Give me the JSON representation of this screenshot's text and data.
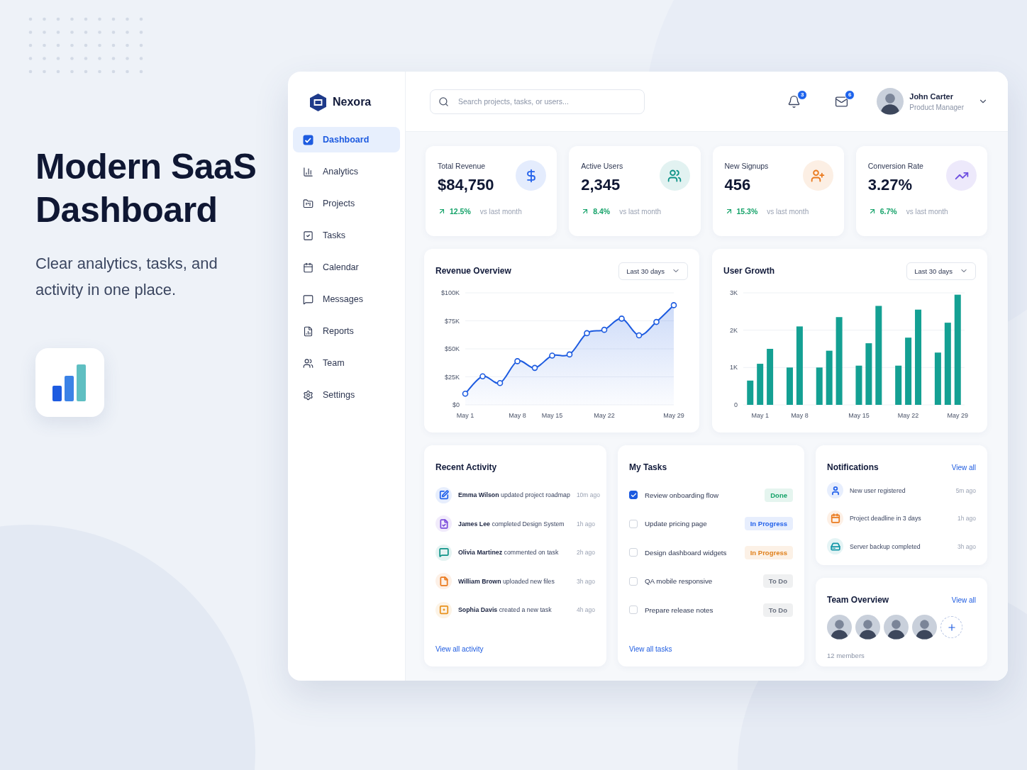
{
  "hero": {
    "title": "Modern SaaS Dashboard",
    "subtitle": "Clear analytics, tasks, and activity in one place."
  },
  "brand": {
    "name": "Nexora"
  },
  "sidebar": {
    "items": [
      {
        "label": "Dashboard",
        "selected": true
      },
      {
        "label": "Analytics",
        "selected": false
      },
      {
        "label": "Projects",
        "selected": false
      },
      {
        "label": "Tasks",
        "selected": false
      },
      {
        "label": "Calendar",
        "selected": false
      },
      {
        "label": "Messages",
        "selected": false
      },
      {
        "label": "Reports",
        "selected": false
      },
      {
        "label": "Team",
        "selected": false
      },
      {
        "label": "Settings",
        "selected": false
      }
    ]
  },
  "header": {
    "search": {
      "placeholder": "Search projects, tasks, or users..."
    },
    "notifications_count": "3",
    "messages_count": "6",
    "user": {
      "name": "John Carter",
      "role": "Product Manager"
    }
  },
  "stats": [
    {
      "title": "Total Revenue",
      "value": "$84,750",
      "change": "12.5%",
      "period": "vs last month",
      "color": "#2563eb"
    },
    {
      "title": "Active Users",
      "value": "2,345",
      "change": "8.4%",
      "period": "vs last month",
      "color": "#0f9488"
    },
    {
      "title": "New Signups",
      "value": "456",
      "change": "15.3%",
      "period": "vs last month",
      "color": "#ea7a1e"
    },
    {
      "title": "Conversion Rate",
      "value": "3.27%",
      "change": "6.7%",
      "period": "vs last month",
      "color": "#6d4ee0"
    }
  ],
  "revenue_overview": {
    "title": "Revenue Overview",
    "range": "Last 30 days",
    "chart_data": {
      "type": "area",
      "categories": [
        "May 1",
        null,
        null,
        "May 8",
        null,
        "May 15",
        null,
        null,
        "May 22",
        null,
        null,
        null,
        "May 29"
      ],
      "grid": true,
      "series": [
        {
          "color": "#1d5be0",
          "values": [
            10,
            25.5,
            19.5,
            39,
            33,
            44,
            45,
            64,
            67,
            77,
            62,
            74,
            89
          ]
        }
      ],
      "ylim": [
        0,
        100
      ],
      "yticks": [
        {
          "value": 0,
          "label": "$0"
        },
        {
          "value": 25,
          "label": "$25K"
        },
        {
          "value": 50,
          "label": "$50K"
        },
        {
          "value": 75,
          "label": "$75K"
        },
        {
          "value": 100,
          "label": "$100K"
        }
      ]
    }
  },
  "user_growth": {
    "title": "User Growth",
    "range": "Last 30 days",
    "chart_data": {
      "type": "bar",
      "categories": [
        null,
        "May 1",
        null,
        null,
        null,
        "May 8",
        null,
        null,
        null,
        null,
        null,
        "May 15",
        null,
        null,
        null,
        null,
        "May 22",
        null,
        null,
        null,
        null,
        "May 29"
      ],
      "grid": true,
      "series": [
        {
          "color": "#14a093",
          "values": [
            650,
            1100,
            1500,
            null,
            1000,
            2100,
            null,
            1000,
            1450,
            2350,
            null,
            1050,
            1650,
            2650,
            null,
            1050,
            1800,
            2550,
            null,
            1400,
            2200,
            2950
          ]
        }
      ],
      "ylim": [
        0,
        3000
      ],
      "yticks": [
        {
          "value": 0,
          "label": "0"
        },
        {
          "value": 1000,
          "label": "1K"
        },
        {
          "value": 2000,
          "label": "2K"
        },
        {
          "value": 3000,
          "label": "3K"
        }
      ]
    }
  },
  "recent_activity": {
    "title": "Recent Activity",
    "items": [
      {
        "text": "**Emma Wilson** updated project roadmap",
        "time": "10m ago",
        "color": "#2563eb"
      },
      {
        "text": "**James Lee** completed Design System",
        "time": "1h ago",
        "color": "#7c4ddc"
      },
      {
        "text": "**Olivia Martinez** commented on task",
        "time": "2h ago",
        "color": "#0f9488"
      },
      {
        "text": "**William Brown** uploaded new files",
        "time": "3h ago",
        "color": "#ea7a1e"
      },
      {
        "text": "**Sophia Davis** created a new task",
        "time": "4h ago",
        "color": "#e8911c"
      }
    ],
    "link": "View all activity"
  },
  "my_tasks": {
    "title": "My Tasks",
    "items": [
      {
        "label": "Review onboarding flow",
        "checked": true,
        "status": {
          "text": "Done",
          "color": "#16a36a"
        }
      },
      {
        "label": "Update pricing page",
        "checked": false,
        "status": {
          "text": "In Progress",
          "color": "#2563eb"
        }
      },
      {
        "label": "Design dashboard widgets",
        "checked": false,
        "status": {
          "text": "In Progress",
          "color": "#e0801c"
        }
      },
      {
        "label": "QA mobile responsive",
        "checked": false,
        "status": {
          "text": "To Do",
          "color": "#6b7280"
        }
      },
      {
        "label": "Prepare release notes",
        "checked": false,
        "status": {
          "text": "To Do",
          "color": "#6b7280"
        }
      }
    ],
    "link": "View all tasks"
  },
  "notifications": {
    "title": "Notifications",
    "link": "View all",
    "items": [
      {
        "text": "New user registered",
        "time": "5m ago",
        "color": "#2563eb"
      },
      {
        "text": "Project deadline in 3 days",
        "time": "1h ago",
        "color": "#ea7a1e"
      },
      {
        "text": "Server backup completed",
        "time": "3h ago",
        "color": "#1597a8"
      }
    ]
  },
  "team_overview": {
    "title": "Team Overview",
    "link": "View all",
    "members": [
      {
        "kind": "avatar"
      },
      {
        "kind": "avatar"
      },
      {
        "kind": "avatar"
      },
      {
        "kind": "avatar"
      }
    ],
    "count": "12 members"
  }
}
